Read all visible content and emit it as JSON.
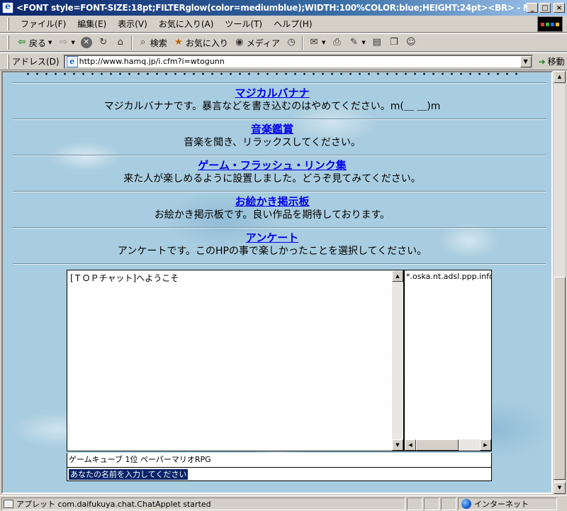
{
  "window": {
    "title": "<FONT style=FONT-SIZE:18pt;FILTERglow(color=mediumblue);WIDTH:100%COLOR:blue;HEIGHT:24pt><BR> - Microsoft Internet Explorer",
    "minimize": "_",
    "maximize": "□",
    "close": "×"
  },
  "menu": [
    "ファイル(F)",
    "編集(E)",
    "表示(V)",
    "お気に入り(A)",
    "ツール(T)",
    "ヘルプ(H)"
  ],
  "toolbar": {
    "back": "戻る",
    "search": "検索",
    "favorites": "お気に入り",
    "media": "メディア"
  },
  "address": {
    "label": "アドレス(D)",
    "url": "http://www.hamq.jp/i.cfm?i=wtogunn",
    "go": "移動"
  },
  "page": {
    "entries": [
      {
        "title": "マジカルバナナ",
        "desc": "マジカルバナナです。暴言などを書き込むのはやめてください。m(＿ ＿)m"
      },
      {
        "title": "音楽鑑賞",
        "desc": "音楽を聞き、リラックスしてください。"
      },
      {
        "title": "ゲーム・フラッシュ・リンク集",
        "desc": "来た人が楽しめるように設置しました。どうぞ見てみてください。"
      },
      {
        "title": "お絵かき掲示板",
        "desc": "お絵かき掲示板です。良い作品を期待しております。"
      },
      {
        "title": "アンケート",
        "desc": "アンケートです。このHPの事で楽しかったことを選択してください。"
      }
    ]
  },
  "chat": {
    "welcome": "[ＴＯＰチャット]へようこそ",
    "user": "*.oska.nt.adsl.ppp.infoweb",
    "status": "ゲームキューブ 1位 ペーパーマリオRPG",
    "name_prompt": "あなたの名前を入力してください"
  },
  "statusbar": {
    "text": "アプレット com.daifukuya.chat.ChatApplet started",
    "zone": "インターネット"
  }
}
